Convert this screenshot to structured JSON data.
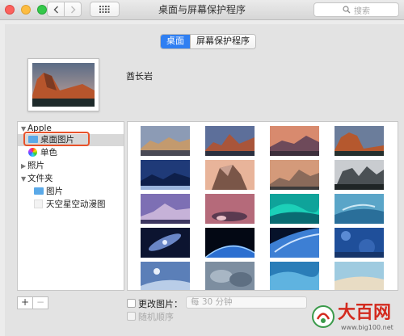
{
  "window": {
    "title": "桌面与屏幕保护程序"
  },
  "toolbar": {
    "search_placeholder": "搜索"
  },
  "tabs": [
    {
      "label": "桌面",
      "active": true
    },
    {
      "label": "屏幕保护程序",
      "active": false
    }
  ],
  "current_picture": {
    "name": "酋长岩"
  },
  "sidebar": {
    "apple_group": "Apple",
    "desktop_pictures": "桌面图片",
    "solid_colors": "单色",
    "photos": "照片",
    "folders_group": "文件夹",
    "pictures": "图片",
    "starry_sky": "天空星空动漫图"
  },
  "bottom": {
    "add": "+",
    "remove": "−",
    "change_picture": "更改图片：",
    "interval": "每 30 分钟",
    "random_order": "随机顺序"
  },
  "watermark": {
    "brand": "大百网",
    "url": "www.big100.net"
  },
  "colors": {
    "accent": "#2f7ff2",
    "highlight_border": "#e8522a",
    "watermark_red": "#d32a1e"
  }
}
